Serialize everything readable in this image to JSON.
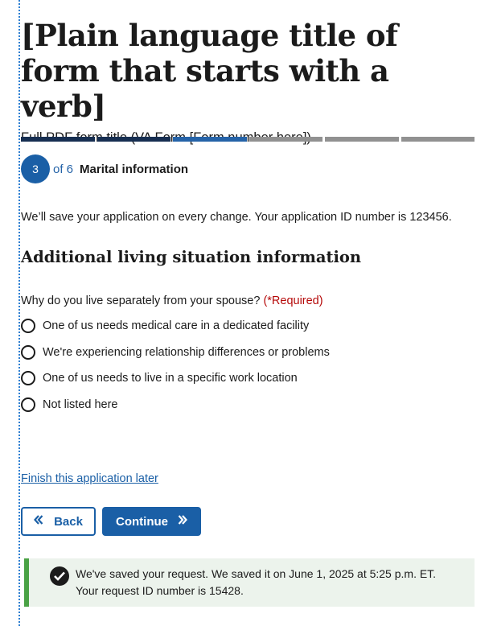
{
  "header": {
    "title": "[Plain language title of form that starts with a verb]",
    "subtitle": "Full PDF form title (VA Form [Form number here])"
  },
  "progress": {
    "total_segments": 6,
    "completed_segments": 2,
    "current_segment": 3
  },
  "step": {
    "number": "3",
    "of_text": "of 6",
    "name": "Marital information"
  },
  "save_note": "We’ll save your application on every change. Your application ID number is 123456.",
  "section": {
    "title": "Additional living situation information"
  },
  "question": {
    "label": "Why do you live separately from your spouse?",
    "required_text": "(*Required)",
    "options": [
      "One of us needs medical care in a dedicated facility",
      "We're experiencing relationship differences or problems",
      "One of us needs to live in a specific work location",
      "Not listed here"
    ]
  },
  "finish_link": "Finish this application later",
  "buttons": {
    "back_label": "Back",
    "continue_label": "Continue",
    "back_icon": "chevron-double-left-icon",
    "continue_icon": "chevron-double-right-icon"
  },
  "alert": {
    "icon": "check-circle-icon",
    "line1": "We've saved your request. We saved it on June 1, 2025 at 5:25 p.m. ET.",
    "line2": "Your request ID number is 15428."
  },
  "colors": {
    "primary": "#1a5fa6",
    "progress_done": "#162e51",
    "progress_current": "#2563a8",
    "progress_todo": "#919191",
    "required": "#b50909",
    "success_border": "#4aa245",
    "success_bg": "#ecf3ec"
  }
}
